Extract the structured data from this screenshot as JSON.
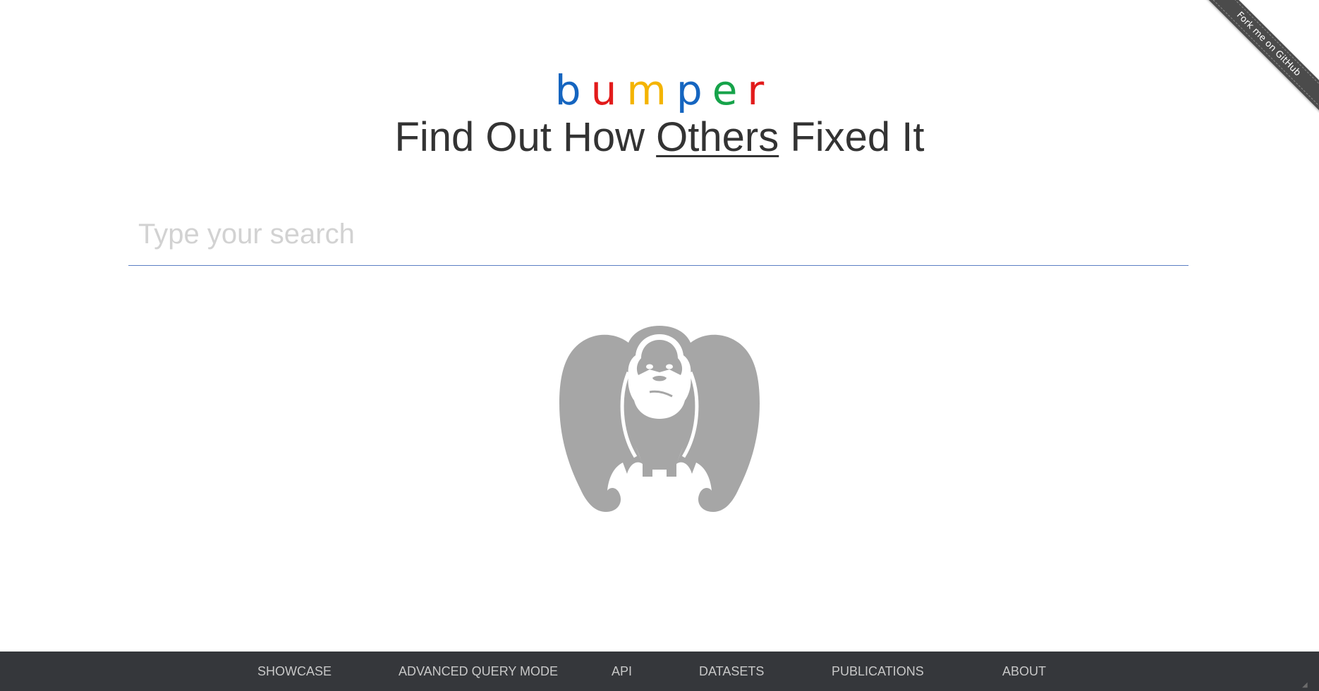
{
  "ribbon": {
    "label": "Fork me on GitHub"
  },
  "logo": {
    "letters": [
      {
        "char": "b",
        "color": "#1565c0"
      },
      {
        "char": "u",
        "color": "#e21b1b"
      },
      {
        "char": "m",
        "color": "#f4b400"
      },
      {
        "char": "p",
        "color": "#1565c0"
      },
      {
        "char": "e",
        "color": "#16a34a"
      },
      {
        "char": "r",
        "color": "#e21b1b"
      }
    ]
  },
  "tagline": {
    "before": "Find Out How ",
    "emphasis": "Others",
    "after": " Fixed It"
  },
  "search": {
    "placeholder": "Type your search",
    "value": ""
  },
  "mascot": {
    "icon": "gorilla-icon",
    "color": "#a6a6a6"
  },
  "footer": {
    "background": "#35373b",
    "links": [
      {
        "label": "SHOWCASE"
      },
      {
        "label": "ADVANCED QUERY MODE"
      },
      {
        "label": "API"
      },
      {
        "label": "DATASETS"
      },
      {
        "label": "PUBLICATIONS"
      },
      {
        "label": "ABOUT"
      }
    ]
  }
}
